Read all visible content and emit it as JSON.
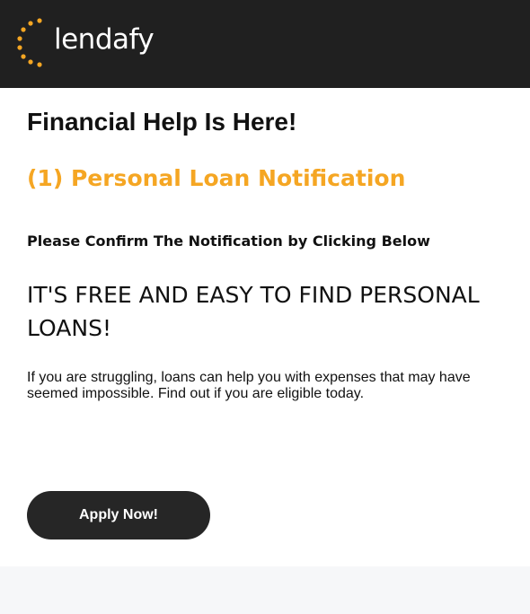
{
  "brand": {
    "name": "lendafy",
    "accent_color": "#f5a623",
    "header_color": "#202020",
    "logo_icon": "sun-dots-icon"
  },
  "content": {
    "headline": "Financial Help Is Here!",
    "notification": "(1) Personal Loan Notification",
    "confirm": "Please Confirm The Notification by Clicking Below",
    "tagline": "IT'S FREE AND EASY TO FIND PERSONAL LOANS!",
    "body": "If you are struggling, loans can help you with expenses that may have seemed impossible. Find out if you are eligible today."
  },
  "cta": {
    "label": "Apply Now!"
  }
}
